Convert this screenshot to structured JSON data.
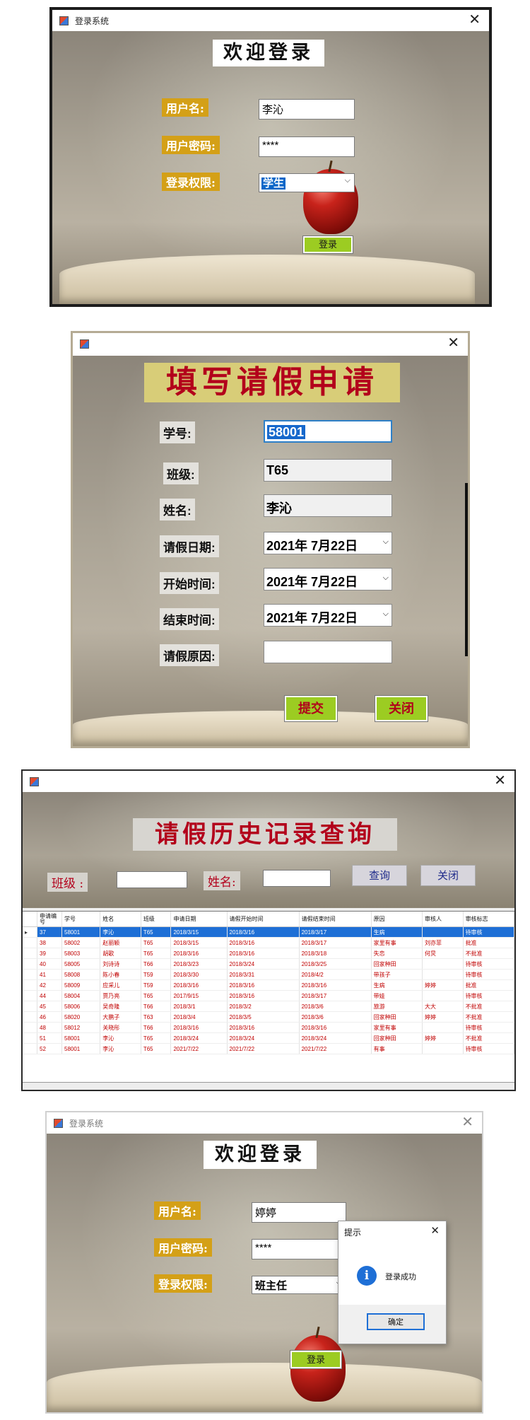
{
  "login1": {
    "window_title": "登录系统",
    "heading": "欢迎登录",
    "username_label": "用户名:",
    "username_value": "李沁",
    "password_label": "用户密码:",
    "password_value": "****",
    "role_label": "登录权限:",
    "role_value": "学生",
    "login_button": "登录"
  },
  "leave_form": {
    "heading": "填写请假申请",
    "fields": [
      {
        "label": "学号:",
        "value": "58001"
      },
      {
        "label": "班级:",
        "value": "T65"
      },
      {
        "label": "姓名:",
        "value": "李沁"
      },
      {
        "label": "请假日期:",
        "value": "2021年  7月22日"
      },
      {
        "label": "开始时间:",
        "value": "2021年  7月22日"
      },
      {
        "label": "结束时间:",
        "value": "2021年  7月22日"
      },
      {
        "label": "请假原因:",
        "value": ""
      }
    ],
    "submit_button": "提交",
    "close_button": "关闭"
  },
  "history": {
    "heading": "请假历史记录查询",
    "class_label": "班级 :",
    "name_label": "姓名:",
    "query_button": "查询",
    "close_button": "关闭",
    "columns": [
      "申请编号",
      "学号",
      "姓名",
      "班级",
      "申请日期",
      "请假开始时间",
      "请假结束时间",
      "原因",
      "审核人",
      "审核标志"
    ],
    "rows": [
      [
        "37",
        "58001",
        "李沁",
        "T65",
        "2018/3/15",
        "2018/3/16",
        "2018/3/17",
        "生病",
        "",
        "待审核"
      ],
      [
        "38",
        "58002",
        "赵丽颖",
        "T65",
        "2018/3/15",
        "2018/3/16",
        "2018/3/17",
        "家里有事",
        "刘亦菲",
        "批准"
      ],
      [
        "39",
        "58003",
        "胡歌",
        "T65",
        "2018/3/16",
        "2018/3/16",
        "2018/3/18",
        "失恋",
        "何炅",
        "不批准"
      ],
      [
        "40",
        "58005",
        "刘诗诗",
        "T66",
        "2018/3/23",
        "2018/3/24",
        "2018/3/25",
        "回家种田",
        "",
        "待审核"
      ],
      [
        "41",
        "58008",
        "陈小春",
        "T59",
        "2018/3/30",
        "2018/3/31",
        "2018/4/2",
        "带孩子",
        "",
        "待审核"
      ],
      [
        "42",
        "58009",
        "应采儿",
        "T59",
        "2018/3/16",
        "2018/3/16",
        "2018/3/16",
        "生病",
        "婷婷",
        "批准"
      ],
      [
        "44",
        "58004",
        "贾乃亮",
        "T65",
        "2017/9/15",
        "2018/3/16",
        "2018/3/17",
        "带娃",
        "",
        "待审核"
      ],
      [
        "45",
        "58006",
        "吴奇隆",
        "T66",
        "2018/3/1",
        "2018/3/2",
        "2018/3/6",
        "旅游",
        "大大",
        "不批准"
      ],
      [
        "46",
        "58020",
        "大鹏子",
        "T63",
        "2018/3/4",
        "2018/3/5",
        "2018/3/6",
        "回家种田",
        "婷婷",
        "不批准"
      ],
      [
        "48",
        "58012",
        "关晓彤",
        "T66",
        "2018/3/16",
        "2018/3/16",
        "2018/3/16",
        "家里有事",
        "",
        "待审核"
      ],
      [
        "51",
        "58001",
        "李沁",
        "T65",
        "2018/3/24",
        "2018/3/24",
        "2018/3/24",
        "回家种田",
        "婷婷",
        "不批准"
      ],
      [
        "52",
        "58001",
        "李沁",
        "T65",
        "2021/7/22",
        "2021/7/22",
        "2021/7/22",
        "有事",
        "",
        "待审核"
      ]
    ]
  },
  "login2": {
    "window_title": "登录系统",
    "heading": "欢迎登录",
    "username_label": "用户名:",
    "username_value": "婷婷",
    "password_label": "用户密码:",
    "password_value": "****",
    "role_label": "登录权限:",
    "role_value": "班主任",
    "login_button": "登录",
    "dialog": {
      "title": "提示",
      "message": "登录成功",
      "ok_button": "确定"
    }
  }
}
